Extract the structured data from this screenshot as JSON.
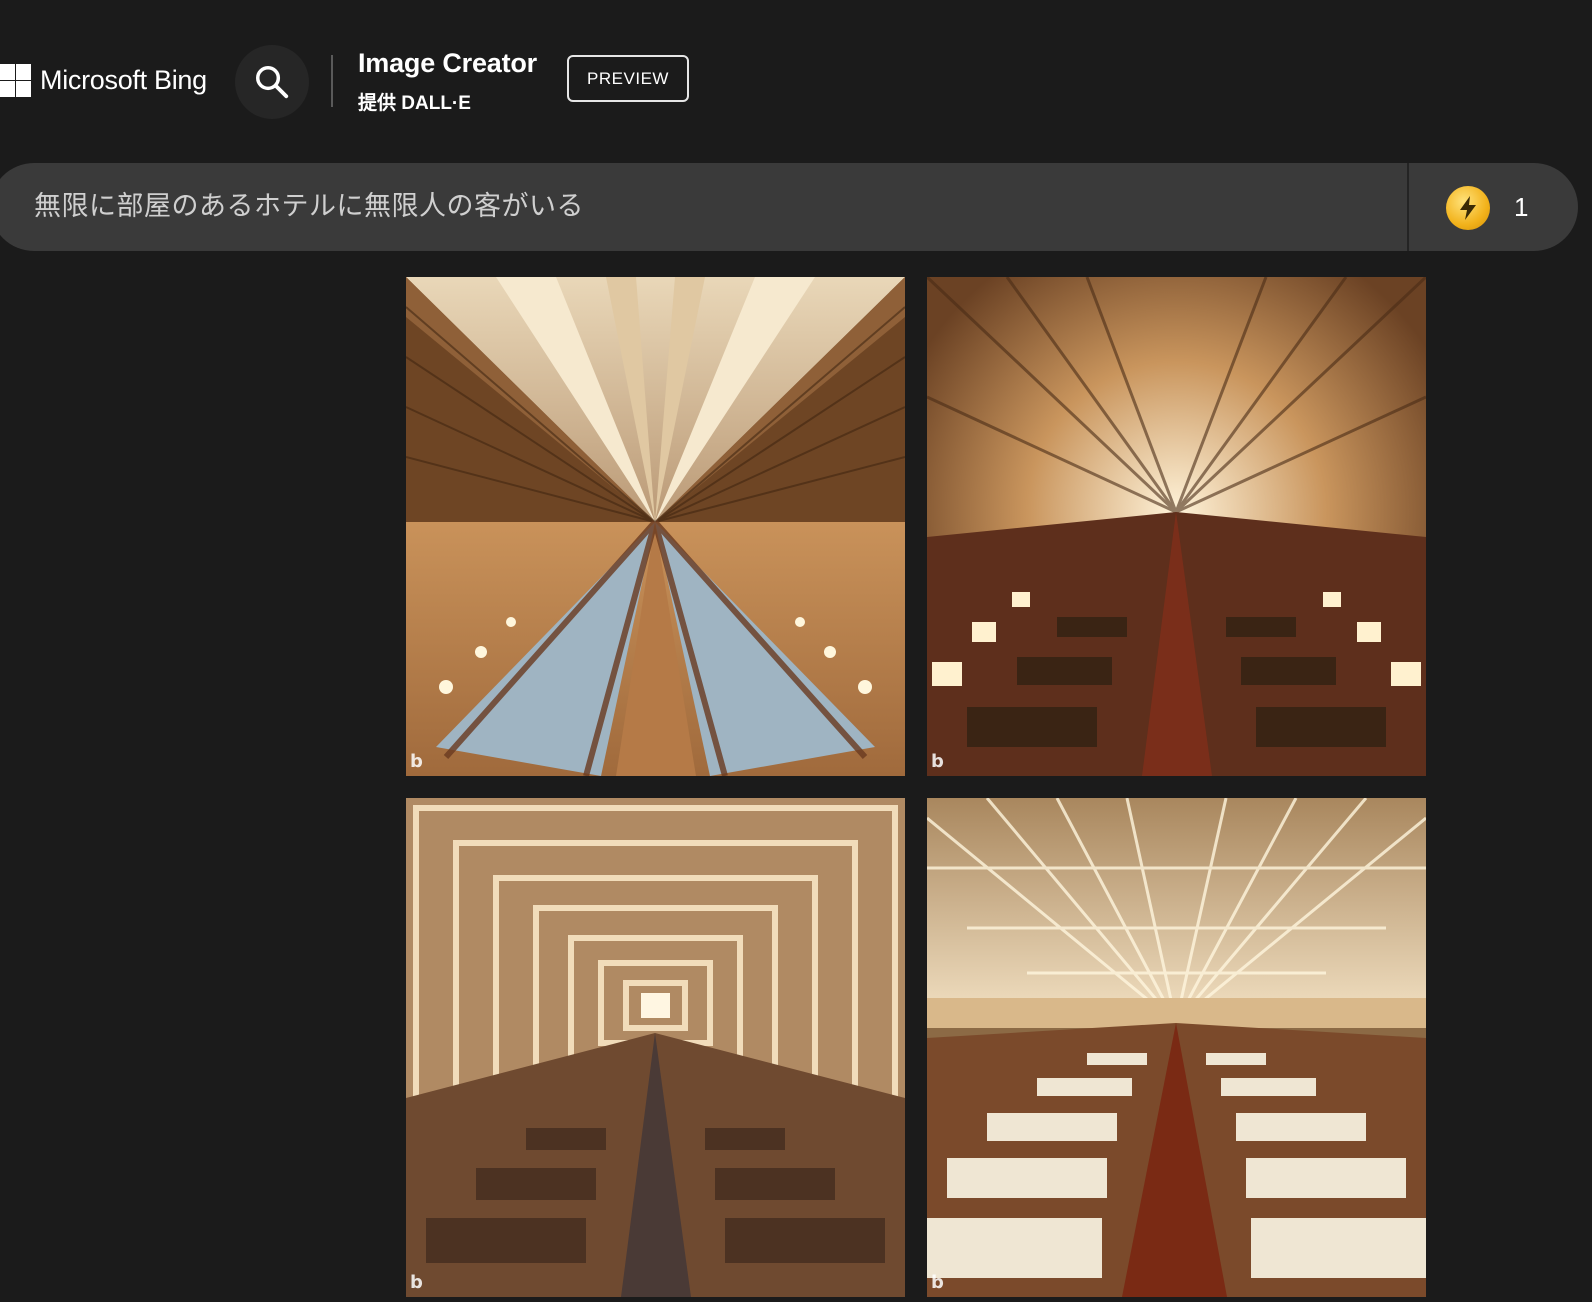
{
  "header": {
    "brand_name": "Microsoft Bing",
    "product_title": "Image Creator",
    "product_subtitle": "提供 DALL·E",
    "preview_label": "PREVIEW"
  },
  "prompt": {
    "text": "無限に部屋のあるホテルに無限人の客がいる",
    "boost_icon": "lightning-bolt-icon",
    "boost_count": "1"
  },
  "results": {
    "images": [
      {
        "description": "Infinite hotel atrium with balconies and rows of blue couches converging to a vanishing point",
        "watermark": "b"
      },
      {
        "description": "Endless lit hotel walls with lamps and rows of sofas converging to a point",
        "watermark": "b"
      },
      {
        "description": "Tunnel-like hotel lounge with nested rectangular frames and rows of sofas",
        "watermark": "b"
      },
      {
        "description": "Long hall with a gridded light ceiling and rows of white beds along a red carpet",
        "watermark": "b"
      }
    ]
  },
  "colors": {
    "background": "#1b1b1b",
    "prompt_bar": "#3a3a3a",
    "boost_gold": "#f2b21b"
  }
}
